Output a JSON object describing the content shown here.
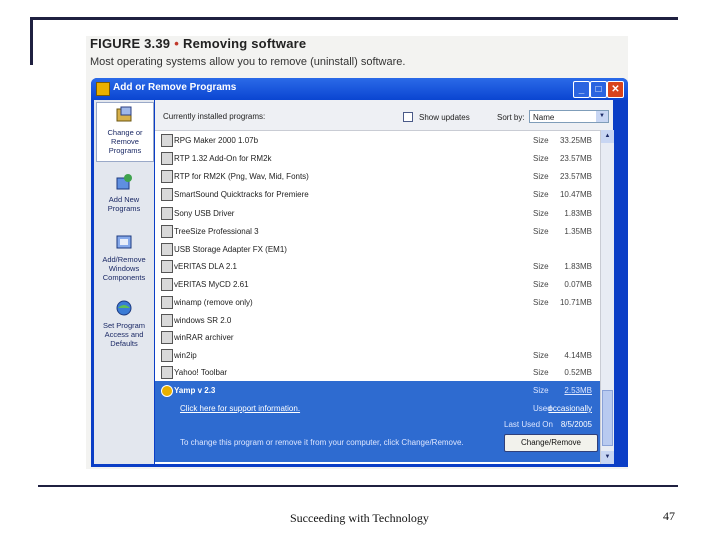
{
  "figure": {
    "label": "FIGURE 3.39",
    "bullet": "•",
    "title": "Removing software",
    "caption": "Most operating systems allow you to remove (uninstall) software."
  },
  "window": {
    "title": "Add or Remove Programs",
    "controls": {
      "minimize": "_",
      "maximize": "□",
      "close": "✕"
    }
  },
  "sidebar": {
    "items": [
      {
        "label": "Change or Remove Programs",
        "icon": "change-remove-icon"
      },
      {
        "label": "Add New Programs",
        "icon": "add-programs-icon"
      },
      {
        "label": "Add/Remove Windows Components",
        "icon": "windows-components-icon"
      },
      {
        "label": "Set Program Access and Defaults",
        "icon": "program-defaults-icon"
      }
    ]
  },
  "toolbar": {
    "currently_installed": "Currently installed programs:",
    "show_updates": "Show updates",
    "sort_by": "Sort by:",
    "sort_value": "Name"
  },
  "programs": [
    {
      "name": "RPG Maker 2000 1.07b",
      "size_label": "Size",
      "size": "33.25MB"
    },
    {
      "name": "RTP 1.32 Add-On for RM2k",
      "size_label": "Size",
      "size": "23.57MB"
    },
    {
      "name": "RTP for RM2K (Png, Wav, Mid, Fonts)",
      "size_label": "Size",
      "size": "23.57MB"
    },
    {
      "name": "SmartSound Quicktracks for Premiere",
      "size_label": "Size",
      "size": "10.47MB"
    },
    {
      "name": "Sony USB Driver",
      "size_label": "Size",
      "size": "1.83MB"
    },
    {
      "name": "TreeSize Professional 3",
      "size_label": "Size",
      "size": "1.35MB"
    },
    {
      "name": "USB Storage Adapter FX (EM1)",
      "size_label": "",
      "size": ""
    },
    {
      "name": "vERITAS DLA 2.1",
      "size_label": "Size",
      "size": "1.83MB"
    },
    {
      "name": "vERITAS MyCD 2.61",
      "size_label": "Size",
      "size": "0.07MB"
    },
    {
      "name": "winamp (remove only)",
      "size_label": "Size",
      "size": "10.71MB"
    },
    {
      "name": "windows SR 2.0",
      "size_label": "",
      "size": ""
    },
    {
      "name": "winRAR archiver",
      "size_label": "",
      "size": ""
    },
    {
      "name": "win2ip",
      "size_label": "Size",
      "size": "4.14MB"
    },
    {
      "name": "Yahoo! Toolbar",
      "size_label": "Size",
      "size": "0.52MB"
    }
  ],
  "selected": {
    "name": "Yamp v 2.3",
    "size_label": "Size",
    "size": "2.53MB",
    "support_link": "Click here for support information.",
    "used_label": "Used",
    "used_value": "occasionally",
    "last_used_label": "Last Used On",
    "last_used_value": "8/5/2005",
    "change_text": "To change this program or remove it from your computer, click Change/Remove.",
    "change_button": "Change/Remove"
  },
  "footer": {
    "text": "Succeeding with Technology",
    "page": "47"
  }
}
